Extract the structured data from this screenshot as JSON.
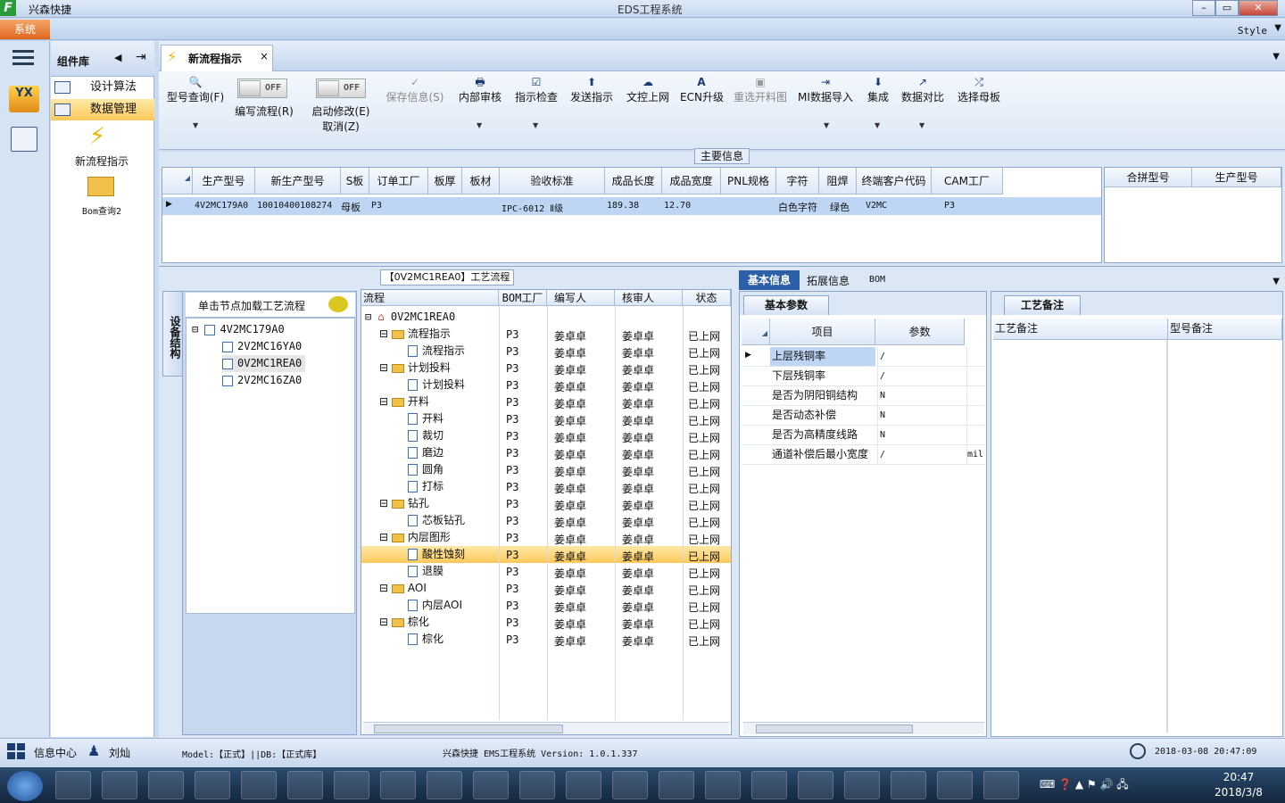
{
  "app": {
    "name": "兴森快捷",
    "window_title": "EDS工程系统",
    "logo": "F",
    "win_buttons": [
      "–",
      "▭",
      "✕"
    ]
  },
  "menu": {
    "system": "系统",
    "style": "Style"
  },
  "components": {
    "title": "组件库",
    "items": [
      {
        "label": "设计算法"
      },
      {
        "label": "数据管理"
      }
    ],
    "tools": [
      {
        "label": "新流程指示"
      },
      {
        "label": "Bom查询2"
      }
    ]
  },
  "tab": {
    "label": "新流程指示",
    "close": "×"
  },
  "toolbar": {
    "buttons": [
      {
        "label": "型号查询(F)",
        "icon": "🔍"
      },
      {
        "label": "编写流程(R)"
      },
      {
        "label": "启动修改(E)",
        "label2": "取消(Z)"
      },
      {
        "label": "保存信息(S)",
        "icon": "✓"
      },
      {
        "label": "内部审核",
        "icon": "🖶"
      },
      {
        "label": "指示检查",
        "icon": "☑"
      },
      {
        "label": "发送指示",
        "icon": "⬆"
      },
      {
        "label": "文控上网",
        "icon": "☁"
      },
      {
        "label": "ECN升级",
        "icon": "A"
      },
      {
        "label": "重选开料图",
        "icon": "▣"
      },
      {
        "label": "MI数据导入",
        "icon": "⇥"
      },
      {
        "label": "集成",
        "icon": "⬇"
      },
      {
        "label": "数据对比",
        "icon": "↗"
      },
      {
        "label": "选择母板",
        "icon": "⤮"
      }
    ],
    "toggle_off": "OFF"
  },
  "main_info": {
    "title": "主要信息",
    "columns": [
      "生产型号",
      "新生产型号",
      "S板",
      "订单工厂",
      "板厚",
      "板材",
      "验收标准",
      "成品长度",
      "成品宽度",
      "PNL规格",
      "字符",
      "阻焊",
      "终端客户代码",
      "CAM工厂"
    ],
    "row": [
      "4V2MC179A0",
      "10010400108274",
      "母板",
      "P3",
      "",
      "",
      "IPC-6012 Ⅱ级",
      "189.38",
      "12.70",
      "",
      "白色字符",
      "绿色",
      "V2MC",
      "P3"
    ],
    "right_columns": [
      "合拼型号",
      "生产型号"
    ]
  },
  "flow": {
    "title": "【0V2MC1REA0】工艺流程",
    "side_tab": "设备结构",
    "hint": "单击节点加载工艺流程",
    "tree": [
      {
        "label": "4V2MC179A0",
        "level": 0
      },
      {
        "label": "2V2MC16YA0",
        "level": 1
      },
      {
        "label": "0V2MC1REA0",
        "level": 1,
        "sel": true
      },
      {
        "label": "2V2MC16ZA0",
        "level": 1
      }
    ],
    "columns": [
      "流程",
      "BOM工厂",
      "编写人",
      "核审人",
      "状态"
    ],
    "root": "0V2MC1REA0",
    "rows": [
      {
        "name": "流程指示",
        "type": "folder",
        "factory": "P3",
        "writer": "姜卓卓",
        "reviewer": "姜卓卓",
        "status": "已上网"
      },
      {
        "name": "流程指示",
        "type": "doc",
        "factory": "P3",
        "writer": "姜卓卓",
        "reviewer": "姜卓卓",
        "status": "已上网"
      },
      {
        "name": "计划投料",
        "type": "folder",
        "factory": "P3",
        "writer": "姜卓卓",
        "reviewer": "姜卓卓",
        "status": "已上网"
      },
      {
        "name": "计划投料",
        "type": "doc",
        "factory": "P3",
        "writer": "姜卓卓",
        "reviewer": "姜卓卓",
        "status": "已上网"
      },
      {
        "name": "开料",
        "type": "folder",
        "factory": "P3",
        "writer": "姜卓卓",
        "reviewer": "姜卓卓",
        "status": "已上网"
      },
      {
        "name": "开料",
        "type": "doc",
        "factory": "P3",
        "writer": "姜卓卓",
        "reviewer": "姜卓卓",
        "status": "已上网"
      },
      {
        "name": "裁切",
        "type": "doc",
        "factory": "P3",
        "writer": "姜卓卓",
        "reviewer": "姜卓卓",
        "status": "已上网"
      },
      {
        "name": "磨边",
        "type": "doc",
        "factory": "P3",
        "writer": "姜卓卓",
        "reviewer": "姜卓卓",
        "status": "已上网"
      },
      {
        "name": "圆角",
        "type": "doc",
        "factory": "P3",
        "writer": "姜卓卓",
        "reviewer": "姜卓卓",
        "status": "已上网"
      },
      {
        "name": "打标",
        "type": "doc",
        "factory": "P3",
        "writer": "姜卓卓",
        "reviewer": "姜卓卓",
        "status": "已上网"
      },
      {
        "name": "钻孔",
        "type": "folder",
        "factory": "P3",
        "writer": "姜卓卓",
        "reviewer": "姜卓卓",
        "status": "已上网"
      },
      {
        "name": "芯板钻孔",
        "type": "doc",
        "factory": "P3",
        "writer": "姜卓卓",
        "reviewer": "姜卓卓",
        "status": "已上网"
      },
      {
        "name": "内层图形",
        "type": "folder",
        "factory": "P3",
        "writer": "姜卓卓",
        "reviewer": "姜卓卓",
        "status": "已上网"
      },
      {
        "name": "酸性蚀刻",
        "type": "doc",
        "factory": "P3",
        "writer": "姜卓卓",
        "reviewer": "姜卓卓",
        "status": "已上网",
        "sel": true
      },
      {
        "name": "退膜",
        "type": "doc",
        "factory": "P3",
        "writer": "姜卓卓",
        "reviewer": "姜卓卓",
        "status": "已上网"
      },
      {
        "name": "AOI",
        "type": "folder",
        "factory": "P3",
        "writer": "姜卓卓",
        "reviewer": "姜卓卓",
        "status": "已上网"
      },
      {
        "name": "内层AOI",
        "type": "doc",
        "factory": "P3",
        "writer": "姜卓卓",
        "reviewer": "姜卓卓",
        "status": "已上网"
      },
      {
        "name": "棕化",
        "type": "folder",
        "factory": "P3",
        "writer": "姜卓卓",
        "reviewer": "姜卓卓",
        "status": "已上网"
      },
      {
        "name": "棕化",
        "type": "doc",
        "factory": "P3",
        "writer": "姜卓卓",
        "reviewer": "姜卓卓",
        "status": "已上网"
      }
    ]
  },
  "right": {
    "tabs": [
      "基本信息",
      "拓展信息",
      "BOM"
    ],
    "params_tab": "基本参数",
    "params_cols": [
      "项目",
      "参数"
    ],
    "params": [
      {
        "item": "上层残铜率",
        "value": "/",
        "unit": ""
      },
      {
        "item": "下层残铜率",
        "value": "/",
        "unit": ""
      },
      {
        "item": "是否为阴阳铜结构",
        "value": "N",
        "unit": ""
      },
      {
        "item": "是否动态补偿",
        "value": "N",
        "unit": ""
      },
      {
        "item": "是否为高精度线路",
        "value": "N",
        "unit": ""
      },
      {
        "item": "通道补偿后最小宽度",
        "value": "/",
        "unit": "mil"
      }
    ],
    "remark_tab": "工艺备注",
    "remark_cols": [
      "工艺备注",
      "型号备注"
    ]
  },
  "status": {
    "info": "信息中心",
    "user": "刘灿",
    "model": "Model:【正式】||DB:【正式库】",
    "version": "兴森快捷 EMS工程系统 Version: 1.0.1.337",
    "datetime": "2018-03-08 20:47:09"
  },
  "taskbar": {
    "time": "20:47",
    "date": "2018/3/8"
  }
}
